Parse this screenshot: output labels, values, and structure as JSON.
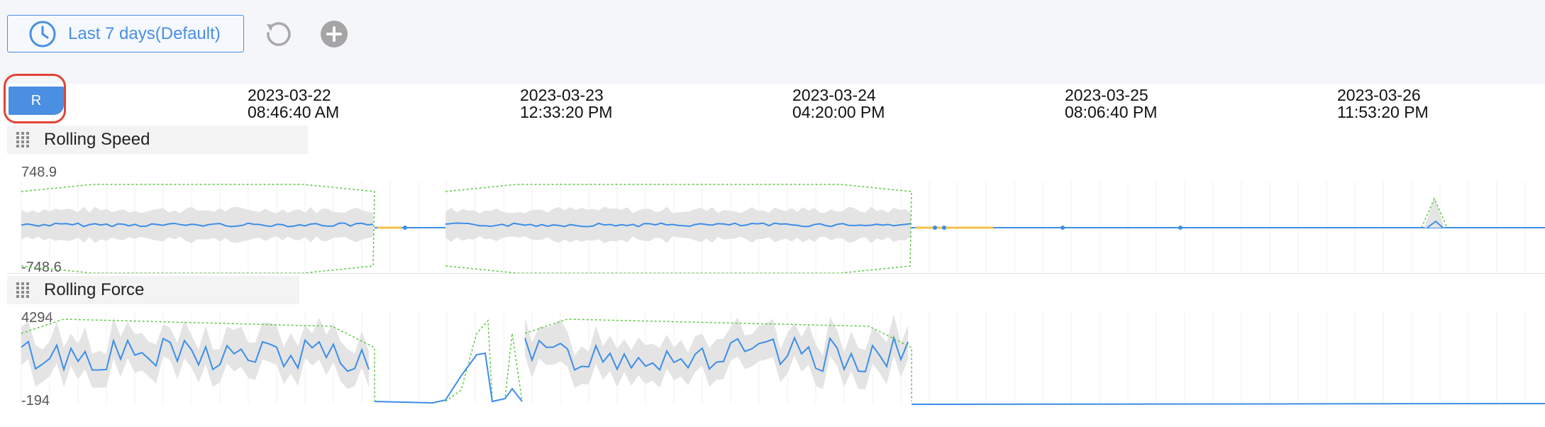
{
  "toolbar": {
    "time_range_label": "Last 7 days(Default)",
    "icons": [
      "clock-icon",
      "refresh-icon",
      "add-icon"
    ]
  },
  "r_button": {
    "label": "R"
  },
  "timeline": {
    "labels": [
      {
        "date": "2023-03-22",
        "time": "08:46:40 AM"
      },
      {
        "date": "2023-03-23",
        "time": "12:33:20 PM"
      },
      {
        "date": "2023-03-24",
        "time": "04:20:00 PM"
      },
      {
        "date": "2023-03-25",
        "time": "08:06:40 PM"
      },
      {
        "date": "2023-03-26",
        "time": "11:53:20 PM"
      }
    ]
  },
  "charts": [
    {
      "title": "Rolling Speed",
      "y_max": "748.9",
      "y_min": "-748.6"
    },
    {
      "title": "Rolling Force",
      "y_max": "4294",
      "y_min": "-194"
    }
  ],
  "colors": {
    "accent": "#4a8fe2",
    "series": "#3d8ee8",
    "band": "#e4e4e4",
    "limit": "#5ec845",
    "gap": "#f5c04a",
    "highlight": "#e04434"
  }
}
